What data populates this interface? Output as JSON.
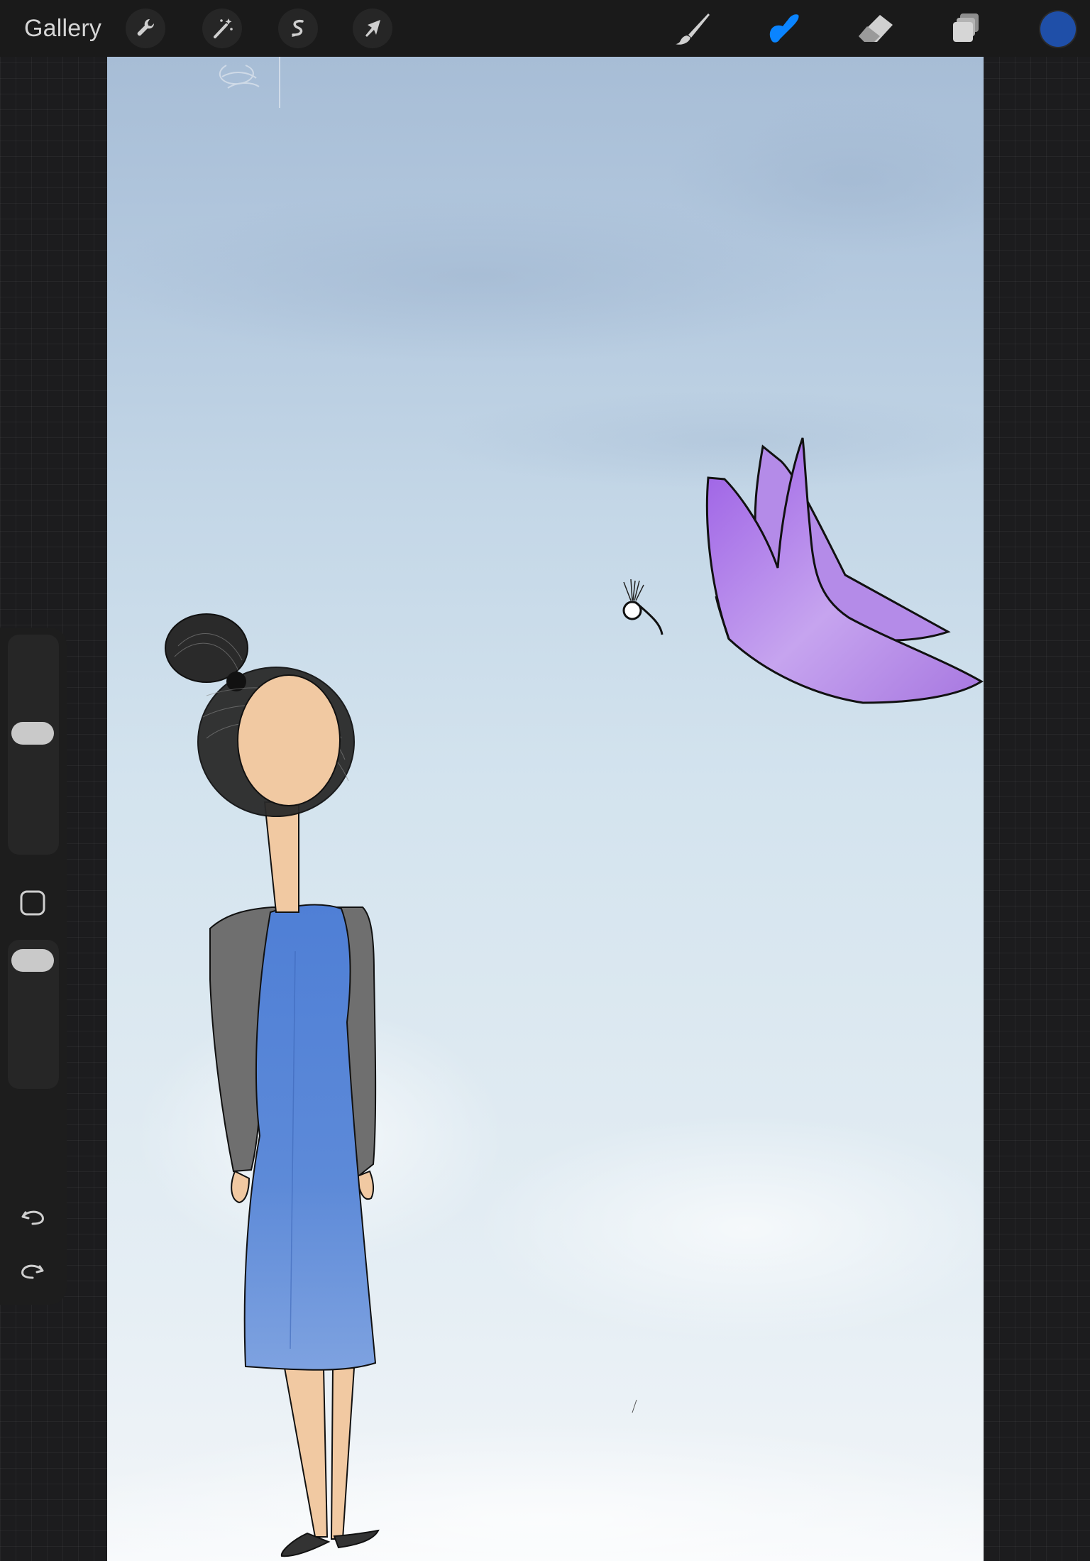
{
  "toolbar": {
    "gallery_label": "Gallery",
    "left_tools": [
      {
        "name": "actions",
        "icon": "wrench-icon"
      },
      {
        "name": "adjustments",
        "icon": "magic-wand-icon"
      },
      {
        "name": "selection",
        "icon": "selection-s-icon"
      },
      {
        "name": "transform",
        "icon": "arrow-cursor-icon"
      }
    ],
    "right_tools": [
      {
        "name": "brush",
        "icon": "brush-icon",
        "active": false
      },
      {
        "name": "smudge",
        "icon": "smudge-finger-icon",
        "active": true
      },
      {
        "name": "eraser",
        "icon": "eraser-icon",
        "active": false
      },
      {
        "name": "layers",
        "icon": "layers-icon",
        "active": false
      }
    ],
    "current_color": "#1f4fa8",
    "active_tool_color": "#0a84ff"
  },
  "sidebar": {
    "brush_size_level": 0.56,
    "opacity_level": 0.96,
    "modifier_icon": "square-modifier-icon",
    "undo_icon": "undo-icon",
    "redo_icon": "redo-icon"
  },
  "canvas": {
    "sky_colors": [
      "#a7bdd6",
      "#d3e3ee",
      "#f8fafc"
    ],
    "dress_color": "#5a86d6",
    "cardigan_color": "#6f6f6f",
    "butterfly_color": "#a472e0",
    "skin_color": "#f2cba4"
  }
}
